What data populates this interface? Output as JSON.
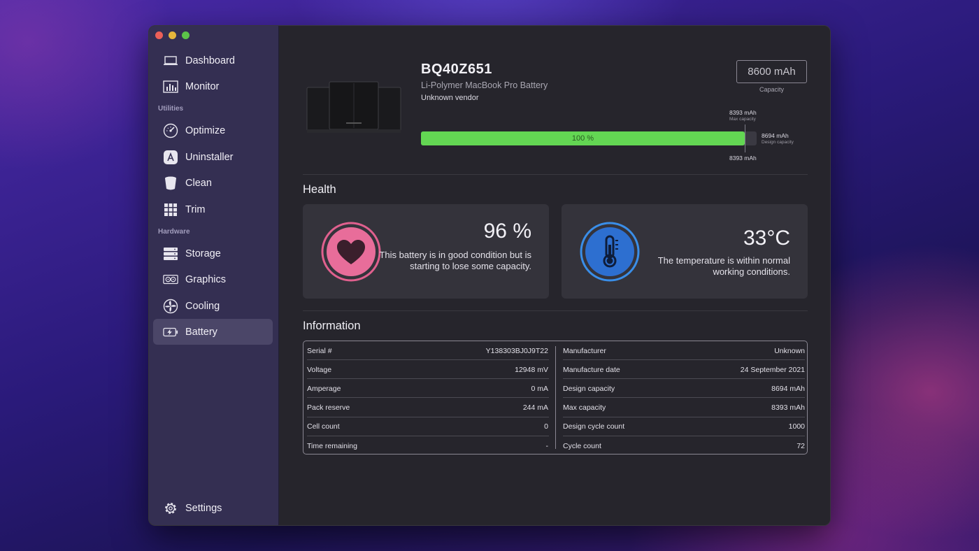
{
  "sidebar": {
    "items": [
      {
        "label": "Dashboard",
        "icon": "laptop-icon"
      },
      {
        "label": "Monitor",
        "icon": "chart-icon"
      }
    ],
    "utilities_label": "Utilities",
    "utilities": [
      {
        "label": "Optimize",
        "icon": "gauge-icon"
      },
      {
        "label": "Uninstaller",
        "icon": "app-store-icon"
      },
      {
        "label": "Clean",
        "icon": "trash-bin-icon"
      },
      {
        "label": "Trim",
        "icon": "grid-icon"
      }
    ],
    "hardware_label": "Hardware",
    "hardware": [
      {
        "label": "Storage",
        "icon": "storage-icon"
      },
      {
        "label": "Graphics",
        "icon": "graphics-card-icon"
      },
      {
        "label": "Cooling",
        "icon": "fan-icon"
      },
      {
        "label": "Battery",
        "icon": "battery-icon",
        "active": true
      }
    ],
    "settings_label": "Settings"
  },
  "battery": {
    "model": "BQ40Z651",
    "type": "Li-Polymer MacBook Pro Battery",
    "vendor": "Unknown vendor",
    "capacity_value": "8600 mAh",
    "capacity_label": "Capacity",
    "max_capacity_value": "8393 mAh",
    "max_capacity_label": "Max capacity",
    "design_capacity_value": "8694 mAh",
    "design_capacity_label": "Design capacity",
    "current_value": "8393 mAh",
    "charge_percent_label": "100 %",
    "charge_fraction": 1.0
  },
  "health": {
    "title": "Health",
    "percent": "96 %",
    "description": "This battery is in good condition but is starting to lose some capacity.",
    "temperature": "33°C",
    "temperature_description": "The temperature is within normal working conditions.",
    "colors": {
      "health": "#e0608e",
      "temperature": "#3a8ee8"
    }
  },
  "information": {
    "title": "Information",
    "left": [
      {
        "label": "Serial #",
        "value": "Y138303BJ0J9T22"
      },
      {
        "label": "Voltage",
        "value": "12948 mV"
      },
      {
        "label": "Amperage",
        "value": "0 mA"
      },
      {
        "label": "Pack reserve",
        "value": "244 mA"
      },
      {
        "label": "Cell count",
        "value": "0"
      },
      {
        "label": "Time remaining",
        "value": "-"
      }
    ],
    "right": [
      {
        "label": "Manufacturer",
        "value": "Unknown"
      },
      {
        "label": "Manufacture date",
        "value": "24 September 2021"
      },
      {
        "label": "Design capacity",
        "value": "8694 mAh"
      },
      {
        "label": "Max capacity",
        "value": "8393 mAh"
      },
      {
        "label": "Design cycle count",
        "value": "1000"
      },
      {
        "label": "Cycle count",
        "value": "72"
      }
    ]
  },
  "colors": {
    "accent_green": "#63d653",
    "sidebar": "#342f52",
    "active_item": "#4b4668"
  }
}
